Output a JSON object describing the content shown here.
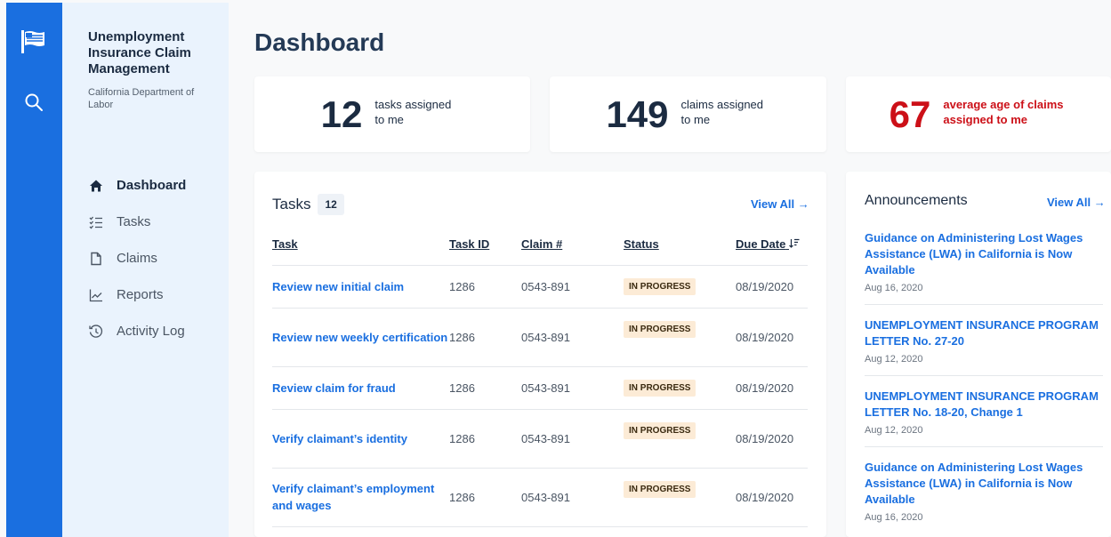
{
  "rail": {
    "flag_icon": "flag-icon",
    "search_icon": "search-icon",
    "color": "#1a6fe0"
  },
  "brand": {
    "title": "Unemployment Insurance Claim Management",
    "subtitle": "California Department of Labor"
  },
  "nav": [
    {
      "label": "Dashboard",
      "icon": "home-icon",
      "active": true
    },
    {
      "label": "Tasks",
      "icon": "checklist-icon",
      "active": false
    },
    {
      "label": "Claims",
      "icon": "file-icon",
      "active": false
    },
    {
      "label": "Reports",
      "icon": "chart-icon",
      "active": false
    },
    {
      "label": "Activity Log",
      "icon": "history-icon",
      "active": false
    }
  ],
  "page": {
    "title": "Dashboard"
  },
  "stats": [
    {
      "value": "12",
      "label": "tasks assigned to me"
    },
    {
      "value": "149",
      "label": "claims assigned to me"
    },
    {
      "value": "67",
      "label": "average age of claims assigned to me",
      "color": "#cc1018"
    }
  ],
  "tasks": {
    "heading": "Tasks",
    "count": "12",
    "view_all": "View All →",
    "columns": [
      "Task",
      "Task ID",
      "Claim #",
      "Status",
      "Due Date"
    ],
    "rows": [
      {
        "task": "Review new initial claim",
        "task_id": "1286",
        "claim": "0543-891",
        "status": "IN PROGRESS",
        "due": "08/19/2020"
      },
      {
        "task": "Review new weekly certification",
        "task_id": "1286",
        "claim": "0543-891",
        "status": "IN PROGRESS",
        "due": "08/19/2020"
      },
      {
        "task": "Review claim for fraud",
        "task_id": "1286",
        "claim": "0543-891",
        "status": "IN PROGRESS",
        "due": "08/19/2020"
      },
      {
        "task": "Verify claimant’s identity",
        "task_id": "1286",
        "claim": "0543-891",
        "status": "IN PROGRESS",
        "due": "08/19/2020"
      },
      {
        "task": "Verify claimant’s employment and wages",
        "task_id": "1286",
        "claim": "0543-891",
        "status": "IN PROGRESS",
        "due": "08/19/2020"
      }
    ]
  },
  "announcements": {
    "heading": "Announcements",
    "view_all": "View All →",
    "items": [
      {
        "title": "Guidance on Administering Lost Wages Assistance (LWA) in California is Now Available",
        "date": "Aug 16, 2020"
      },
      {
        "title": "UNEMPLOYMENT INSURANCE PROGRAM LETTER No. 27-20",
        "date": "Aug 12, 2020"
      },
      {
        "title": "UNEMPLOYMENT INSURANCE PROGRAM LETTER No. 18-20, Change 1",
        "date": "Aug 12, 2020"
      },
      {
        "title": "Guidance on Administering Lost Wages Assistance (LWA) in California is Now Available",
        "date": "Aug 16, 2020"
      }
    ]
  }
}
